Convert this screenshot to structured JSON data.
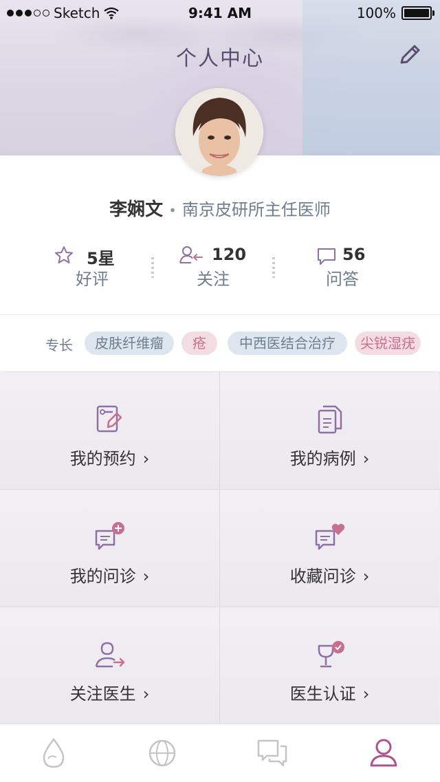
{
  "status_bar": {
    "carrier": "Sketch",
    "time": "9:41 AM",
    "battery": "100%"
  },
  "header": {
    "title": "个人中心"
  },
  "profile": {
    "name": "李娴文",
    "separator": "•",
    "title": "南京皮研所主任医师"
  },
  "stats": [
    {
      "value": "5星",
      "label": "好评",
      "icon": "star-icon"
    },
    {
      "value": "120",
      "label": "关注",
      "icon": "follow-user-icon"
    },
    {
      "value": "56",
      "label": "问答",
      "icon": "chat-bubble-icon"
    }
  ],
  "specialty": {
    "label": "专长",
    "tags": [
      {
        "text": "皮肤纤维瘤",
        "style": "blue"
      },
      {
        "text": "疮",
        "style": "pink"
      },
      {
        "text": "中西医结合治疗",
        "style": "blue"
      },
      {
        "text": "尖锐湿疣",
        "style": "pink"
      }
    ]
  },
  "menu": [
    {
      "label": "我的预约",
      "icon": "appointment-icon"
    },
    {
      "label": "我的病例",
      "icon": "document-icon"
    },
    {
      "label": "我的问诊",
      "icon": "consultation-add-icon"
    },
    {
      "label": "收藏问诊",
      "icon": "consultation-favorite-icon"
    },
    {
      "label": "关注医生",
      "icon": "follow-doctor-icon"
    },
    {
      "label": "医生认证",
      "icon": "doctor-certification-icon"
    }
  ],
  "menu_chevron": "›",
  "tabbar": [
    {
      "name": "drop-icon",
      "active": false
    },
    {
      "name": "globe-icon",
      "active": false
    },
    {
      "name": "chat-icon",
      "active": false
    },
    {
      "name": "profile-icon",
      "active": true
    }
  ],
  "colors": {
    "accent": "#b4508f",
    "text_secondary": "#6f7e8d",
    "icon_purple": "#8e6fa6",
    "pink": "#c86f8f"
  }
}
